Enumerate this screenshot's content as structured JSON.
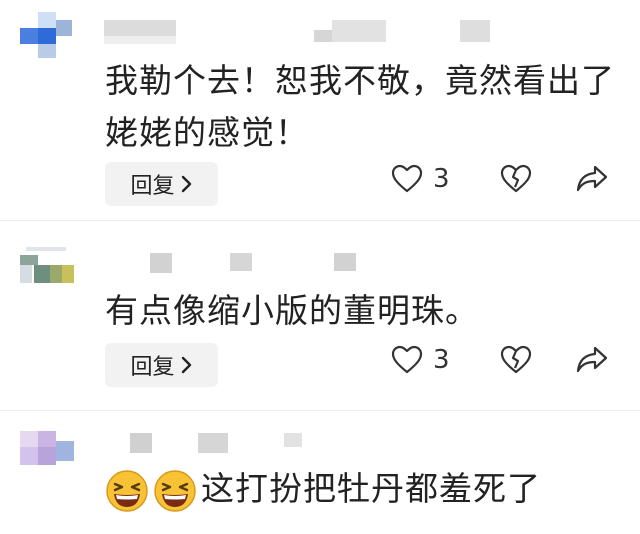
{
  "comments": [
    {
      "text": "我勒个去！恕我不敬，竟然看出了姥姥的感觉！",
      "reply_label": "回复",
      "like_count": "3"
    },
    {
      "text": "有点像缩小版的董明珠。",
      "reply_label": "回复",
      "like_count": "3"
    },
    {
      "text": "这打扮把牡丹都羞死了",
      "emoji": "grinning-squinting-face"
    }
  ],
  "icons": {
    "reply_chevron": "chevron-right-icon",
    "like": "heart-icon",
    "dislike": "broken-heart-icon",
    "share": "share-arrow-icon"
  },
  "colors": {
    "background": "#ffffff",
    "reply_button_bg": "#f2f2f2",
    "text": "#222222",
    "icon_stroke": "#333333"
  }
}
